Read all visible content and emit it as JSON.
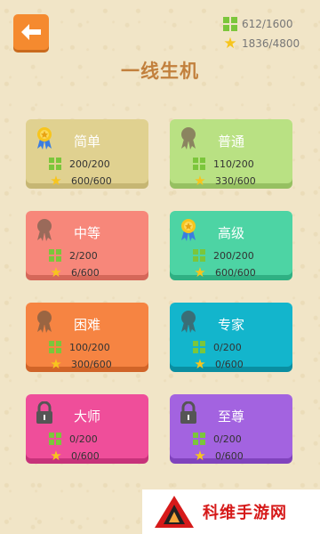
{
  "header": {
    "title": "一线生机",
    "puzzles_progress": "612/1600",
    "stars_progress": "1836/4800"
  },
  "colors": {
    "background": "#f1e5c7",
    "accent_orange": "#f58a2f",
    "title_brown": "#c2803d",
    "grid_green": "#7bc63b",
    "star_yellow": "#f7c51d"
  },
  "levels": [
    {
      "name": "简单",
      "puzzles": "200/200",
      "stars": "600/600",
      "status": "gold-medal",
      "bg": "#e0d190",
      "shadow": "#c6b673",
      "icon_color": "#a0917a"
    },
    {
      "name": "普通",
      "puzzles": "110/200",
      "stars": "330/600",
      "status": "medal",
      "bg": "#b9e183",
      "shadow": "#96c061",
      "icon_color": "#8b8460"
    },
    {
      "name": "中等",
      "puzzles": "2/200",
      "stars": "6/600",
      "status": "medal",
      "bg": "#f7877a",
      "shadow": "#d56759",
      "icon_color": "#9a6a5a"
    },
    {
      "name": "高级",
      "puzzles": "200/200",
      "stars": "600/600",
      "status": "gold-medal",
      "bg": "#4dd4a4",
      "shadow": "#2fb083",
      "icon_color": "#6a8a70"
    },
    {
      "name": "困难",
      "puzzles": "100/200",
      "stars": "300/600",
      "status": "medal",
      "bg": "#f68442",
      "shadow": "#d06428",
      "icon_color": "#9a6542"
    },
    {
      "name": "专家",
      "puzzles": "0/200",
      "stars": "0/600",
      "status": "medal",
      "bg": "#13b5cc",
      "shadow": "#0a8ea1",
      "icon_color": "#3a6e76"
    },
    {
      "name": "大师",
      "puzzles": "0/200",
      "stars": "0/600",
      "status": "locked",
      "bg": "#ef4e9a",
      "shadow": "#c7327a",
      "icon_color": "#555555"
    },
    {
      "name": "至尊",
      "puzzles": "0/200",
      "stars": "0/600",
      "status": "locked",
      "bg": "#a363e0",
      "shadow": "#8043bd",
      "icon_color": "#555555"
    }
  ],
  "watermark": {
    "text": "科维手游网"
  }
}
